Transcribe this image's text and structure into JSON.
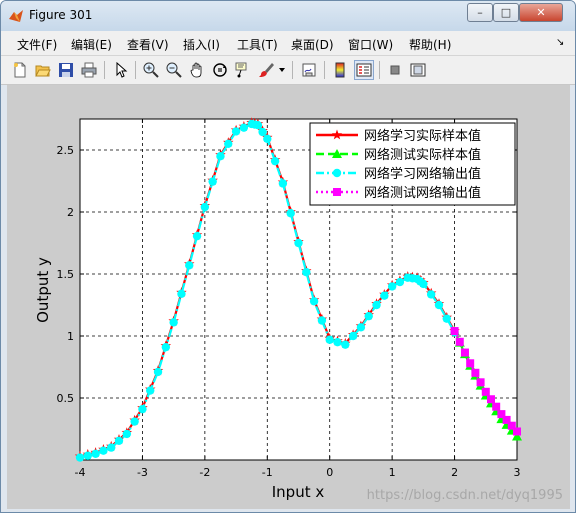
{
  "window": {
    "title": "Figure 301",
    "buttons": {
      "minimize": "–",
      "maximize": "□",
      "close": "✕"
    }
  },
  "menu": {
    "items": [
      "文件(F)",
      "编辑(E)",
      "查看(V)",
      "插入(I)",
      "工具(T)",
      "桌面(D)",
      "窗口(W)",
      "帮助(H)"
    ],
    "dock_arrow": "↘"
  },
  "toolbar": {
    "icons": [
      "new-file-icon",
      "open-folder-icon",
      "save-icon",
      "print-icon",
      "pointer-icon",
      "zoom-in-icon",
      "zoom-out-icon",
      "pan-hand-icon",
      "rotate-3d-icon",
      "data-cursor-icon",
      "brush-icon",
      "brush-dropdown-icon",
      "link-plot-icon",
      "colorbar-icon",
      "legend-icon",
      "hide-plot-tools-icon",
      "show-plot-tools-icon"
    ]
  },
  "watermark": "https://blog.csdn.net/dyq1995",
  "colors": {
    "red": "#ff0000",
    "green": "#00ff00",
    "cyan": "#00ffff",
    "magenta": "#ff00ff"
  },
  "chart_data": {
    "type": "line",
    "xlabel": "Input x",
    "ylabel": "Output y",
    "xlim": [
      -4,
      3
    ],
    "ylim": [
      0,
      2.75
    ],
    "xticks": [
      -4,
      -3,
      -2,
      -1,
      0,
      1,
      2,
      3
    ],
    "xtick_labels": [
      "-4",
      "-3",
      "-2",
      "-1",
      "0",
      "1",
      "2",
      "3"
    ],
    "yticks": [
      0.5,
      1,
      1.5,
      2,
      2.5
    ],
    "ytick_labels": [
      "0.5",
      "1",
      "1.5",
      "2",
      "2.5"
    ],
    "grid": true,
    "legend_position": "top-right",
    "series": [
      {
        "name": "网络学习实际样本值",
        "color": "#ff0000",
        "style": "solid",
        "marker": "star",
        "x": [
          -4,
          -3.75,
          -3.5,
          -3.25,
          -3,
          -2.75,
          -2.5,
          -2.25,
          -2,
          -1.75,
          -1.5,
          -1.25,
          -1.15,
          -1,
          -0.75,
          -0.5,
          -0.25,
          0,
          0.25,
          0.5,
          0.75,
          1,
          1.25,
          1.4,
          1.5,
          1.75,
          2
        ],
        "y": [
          0.03,
          0.06,
          0.11,
          0.22,
          0.42,
          0.72,
          1.12,
          1.58,
          2.05,
          2.46,
          2.66,
          2.72,
          2.71,
          2.6,
          2.24,
          1.76,
          1.29,
          0.98,
          0.94,
          1.08,
          1.26,
          1.41,
          1.48,
          1.47,
          1.43,
          1.26,
          1.04
        ]
      },
      {
        "name": "网络测试实际样本值",
        "color": "#00ff00",
        "style": "dashed",
        "marker": "triangle",
        "x": [
          2,
          2.25,
          2.5,
          2.75,
          3
        ],
        "y": [
          1.04,
          0.76,
          0.52,
          0.33,
          0.19
        ]
      },
      {
        "name": "网络学习网络输出值",
        "color": "#00ffff",
        "style": "dashdot",
        "marker": "circle",
        "x": [
          -4,
          -3.75,
          -3.5,
          -3.25,
          -3,
          -2.75,
          -2.5,
          -2.25,
          -2,
          -1.75,
          -1.5,
          -1.25,
          -1.15,
          -1,
          -0.75,
          -0.5,
          -0.25,
          0,
          0.25,
          0.5,
          0.75,
          1,
          1.25,
          1.4,
          1.5,
          1.75,
          2
        ],
        "y": [
          0.02,
          0.05,
          0.1,
          0.21,
          0.41,
          0.71,
          1.11,
          1.57,
          2.04,
          2.45,
          2.65,
          2.71,
          2.7,
          2.59,
          2.23,
          1.75,
          1.28,
          0.97,
          0.93,
          1.07,
          1.25,
          1.4,
          1.47,
          1.46,
          1.42,
          1.25,
          1.03
        ]
      },
      {
        "name": "网络测试网络输出值",
        "color": "#ff00ff",
        "style": "dotted",
        "marker": "square",
        "x": [
          2,
          2.25,
          2.5,
          2.75,
          3
        ],
        "y": [
          1.04,
          0.78,
          0.55,
          0.37,
          0.23
        ]
      }
    ]
  }
}
